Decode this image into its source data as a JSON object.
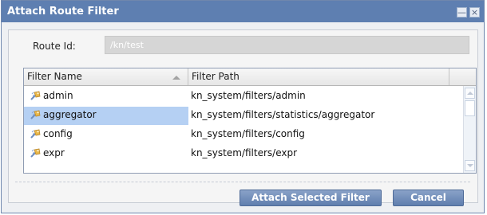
{
  "dialog": {
    "title": "Attach Route Filter",
    "minimize_glyph": "—",
    "close_glyph": "×"
  },
  "route": {
    "label": "Route Id:",
    "value": "/kn/test"
  },
  "table": {
    "columns": [
      "Filter Name",
      "Filter Path",
      ""
    ],
    "sort": {
      "column": "Filter Name",
      "direction": "ascending"
    },
    "rows": [
      {
        "name": "admin",
        "path": "kn_system/filters/admin",
        "selected": false,
        "icon": "filter-icon"
      },
      {
        "name": "aggregator",
        "path": "kn_system/filters/statistics/aggregator",
        "selected": true,
        "icon": "filter-icon"
      },
      {
        "name": "config",
        "path": "kn_system/filters/config",
        "selected": false,
        "icon": "filter-icon"
      },
      {
        "name": "expr",
        "path": "kn_system/filters/expr",
        "selected": false,
        "icon": "filter-icon"
      }
    ]
  },
  "buttons": {
    "attach": "Attach Selected Filter",
    "cancel": "Cancel"
  },
  "colors": {
    "titlebar": "#5e7fb1",
    "selected_row": "#b5d0f3",
    "button": "#6f8dbb"
  }
}
